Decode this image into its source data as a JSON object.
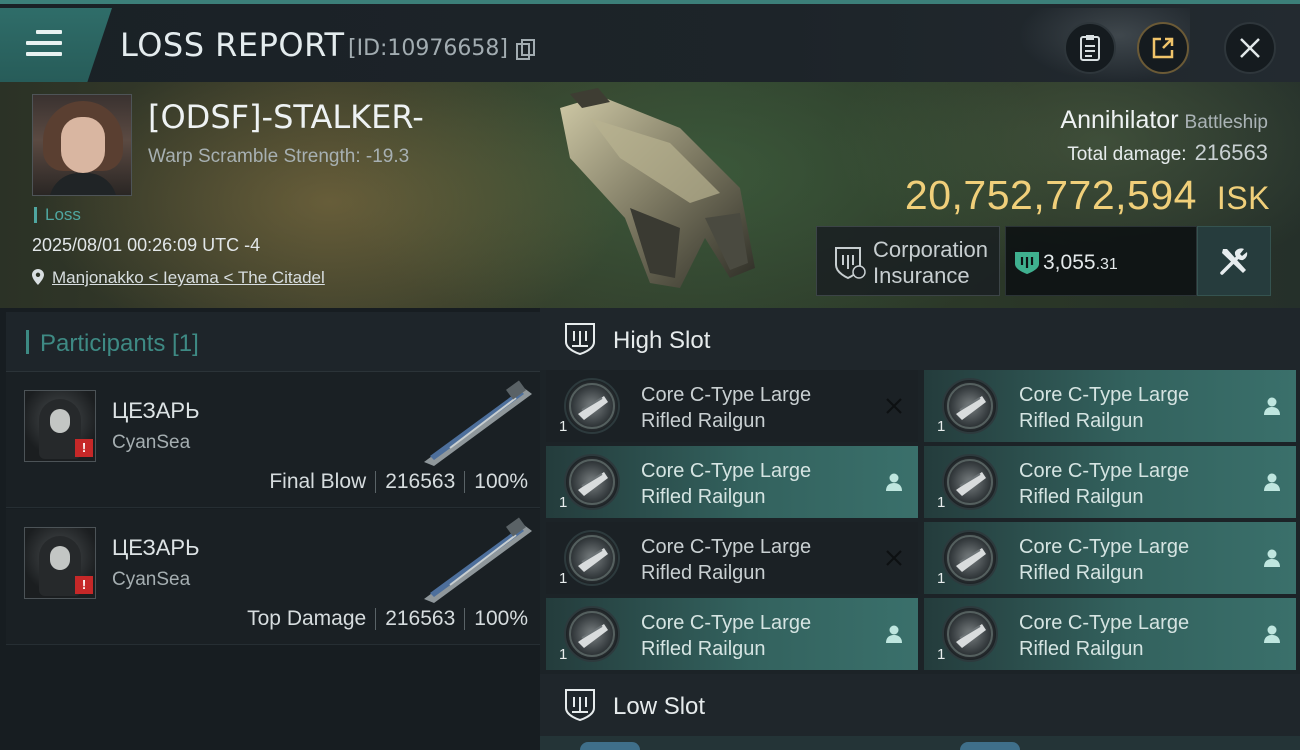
{
  "header": {
    "title": "LOSS REPORT",
    "report_id": "[ID:10976658]"
  },
  "victim": {
    "pilot_name": "[ODSF]-STALKER-",
    "warp_scramble": "Warp Scramble Strength: -19.3",
    "result": "Loss",
    "datetime": "2025/08/01 00:26:09 UTC -4",
    "location": "Manjonakko < Ieyama < The Citadel",
    "ship_name": "Annihilator",
    "ship_class": "Battleship",
    "total_damage_label": "Total damage:",
    "total_damage_value": "216563",
    "isk_value": "20,752,772,594",
    "isk_unit": "ISK",
    "insurance_label_line1": "Corporation",
    "insurance_label_line2": "Insurance",
    "insurance_value_main": "3,055",
    "insurance_value_decimal": ".31"
  },
  "participants": {
    "header_label": "Participants [1]",
    "items": [
      {
        "name": "ЦЕЗАРЬ",
        "corp": "CyanSea",
        "role": "Final Blow",
        "damage": "216563",
        "percent": "100%"
      },
      {
        "name": "ЦЕЗАРЬ",
        "corp": "CyanSea",
        "role": "Top Damage",
        "damage": "216563",
        "percent": "100%"
      }
    ]
  },
  "slots": {
    "high_label": "High Slot",
    "low_label": "Low Slot",
    "high_modules": [
      {
        "line1": "Core C-Type Large",
        "line2": "Rifled Railgun",
        "qty": "1",
        "status": "destroyed"
      },
      {
        "line1": "Core C-Type Large",
        "line2": "Rifled Railgun",
        "qty": "1",
        "status": "dropped"
      },
      {
        "line1": "Core C-Type Large",
        "line2": "Rifled Railgun",
        "qty": "1",
        "status": "dropped"
      },
      {
        "line1": "Core C-Type Large",
        "line2": "Rifled Railgun",
        "qty": "1",
        "status": "dropped"
      },
      {
        "line1": "Core C-Type Large",
        "line2": "Rifled Railgun",
        "qty": "1",
        "status": "destroyed"
      },
      {
        "line1": "Core C-Type Large",
        "line2": "Rifled Railgun",
        "qty": "1",
        "status": "dropped"
      },
      {
        "line1": "Core C-Type Large",
        "line2": "Rifled Railgun",
        "qty": "1",
        "status": "dropped"
      },
      {
        "line1": "Core C-Type Large",
        "line2": "Rifled Railgun",
        "qty": "1",
        "status": "dropped"
      }
    ]
  },
  "icons": {
    "menu": "hamburger-icon",
    "copy": "copy-icon",
    "clipboard": "clipboard-icon",
    "export": "export-icon",
    "close": "close-icon",
    "location": "location-pin-icon",
    "insurance": "insurance-shield-icon",
    "fitting": "tools-icon",
    "slot": "slot-shield-icon",
    "destroyed": "x-icon",
    "dropped": "person-icon"
  },
  "colors": {
    "accent_teal": "#3c7f79",
    "isk_gold": "#f0cf7a",
    "fitted_module": "#33625e",
    "alert_red": "#c62828"
  }
}
